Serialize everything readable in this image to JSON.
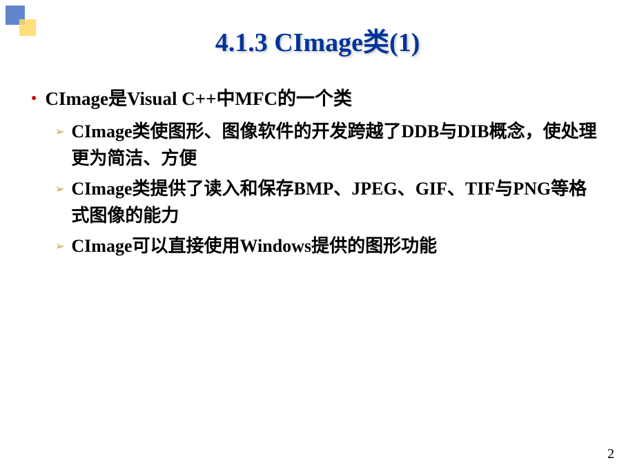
{
  "title": "4.1.3 CImage类(1)",
  "mainBullet": {
    "text": "CImage是Visual C++中MFC的一个类"
  },
  "subBullets": [
    {
      "text": "CImage类使图形、图像软件的开发跨越了DDB与DIB概念，使处理更为简洁、方便"
    },
    {
      "text": "CImage类提供了读入和保存BMP、JPEG、GIF、TIF与PNG等格式图像的能力"
    },
    {
      "text": "CImage可以直接使用Windows提供的图形功能"
    }
  ],
  "pageNumber": "2"
}
